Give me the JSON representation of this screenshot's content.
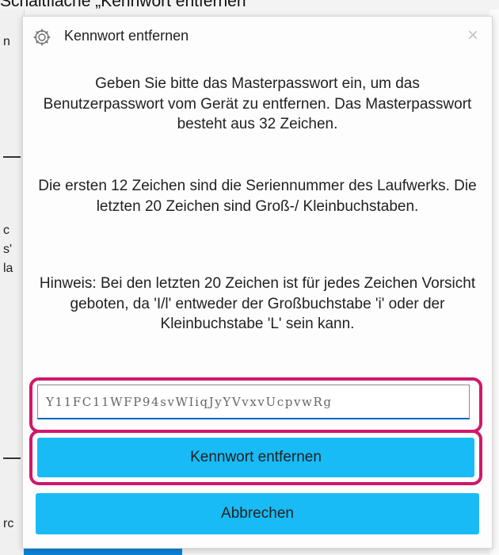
{
  "background": {
    "caption": "Schaltfläche „Kennwort entfernen\"",
    "left_fragments": [
      "n",
      "c",
      "s'",
      "la",
      "rc"
    ]
  },
  "dialog": {
    "title": "Kennwort entfernen",
    "close_glyph": "×",
    "message1": "Geben Sie bitte das Masterpasswort ein, um das Benutzerpasswort vom Gerät zu entfernen. Das Masterpasswort besteht aus 32 Zeichen.",
    "message2": "Die ersten 12 Zeichen sind die Seriennummer des Laufwerks. Die letzten 20 Zeichen sind Groß-/ Kleinbuchstaben.",
    "message3": "Hinweis: Bei den letzten 20 Zeichen ist für jedes Zeichen Vorsicht geboten, da 'I/l' entweder der Großbuchstabe 'i' oder der Kleinbuchstabe 'L' sein kann.",
    "password_value": "Y11FC11WFP94svWIiqJyYVvxvUcpvwRg",
    "remove_button": "Kennwort entfernen",
    "cancel_button": "Abbrechen"
  },
  "colors": {
    "accent_button": "#18bbf6",
    "highlight": "#d0186b",
    "input_focus": "#0067c0"
  },
  "icons": {
    "title": "gear-icon",
    "close": "close-icon"
  }
}
